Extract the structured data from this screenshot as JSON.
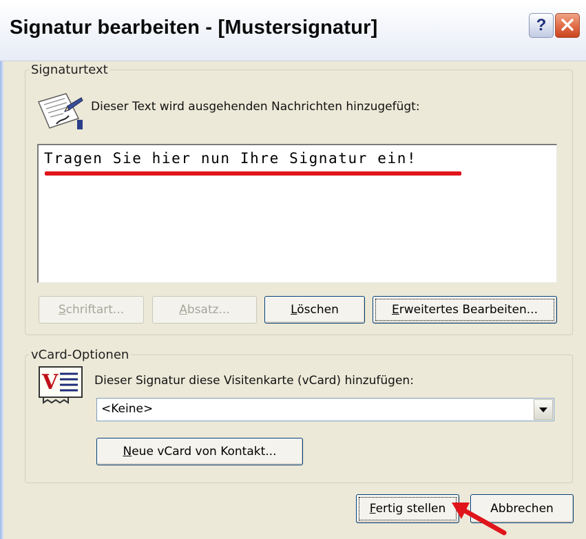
{
  "window": {
    "title": "Signatur bearbeiten - [Mustersignatur]",
    "help_glyph": "?"
  },
  "signature_group": {
    "legend": "Signaturtext",
    "description": "Dieser Text wird ausgehenden Nachrichten hinzugefügt:",
    "text_value": "Tragen Sie hier nun Ihre Signatur ein!",
    "annotation_color": "#e0141b",
    "buttons": {
      "font": "Schriftart...",
      "paragraph": "Absatz...",
      "delete": "Löschen",
      "advanced_edit": "Erweitertes Bearbeiten..."
    }
  },
  "vcard_group": {
    "legend": "vCard-Optionen",
    "description": "Dieser Signatur diese Visitenkarte (vCard) hinzufügen:",
    "select_value": "<Keine>",
    "new_vcard_button": "Neue vCard von Kontakt..."
  },
  "footer": {
    "finish_button": "Fertig stellen",
    "cancel_button": "Abbrechen"
  },
  "icons": {
    "signature": "pen-on-paper-icon",
    "vcard": "vcard-icon",
    "annotation": "red-arrow-icon"
  }
}
